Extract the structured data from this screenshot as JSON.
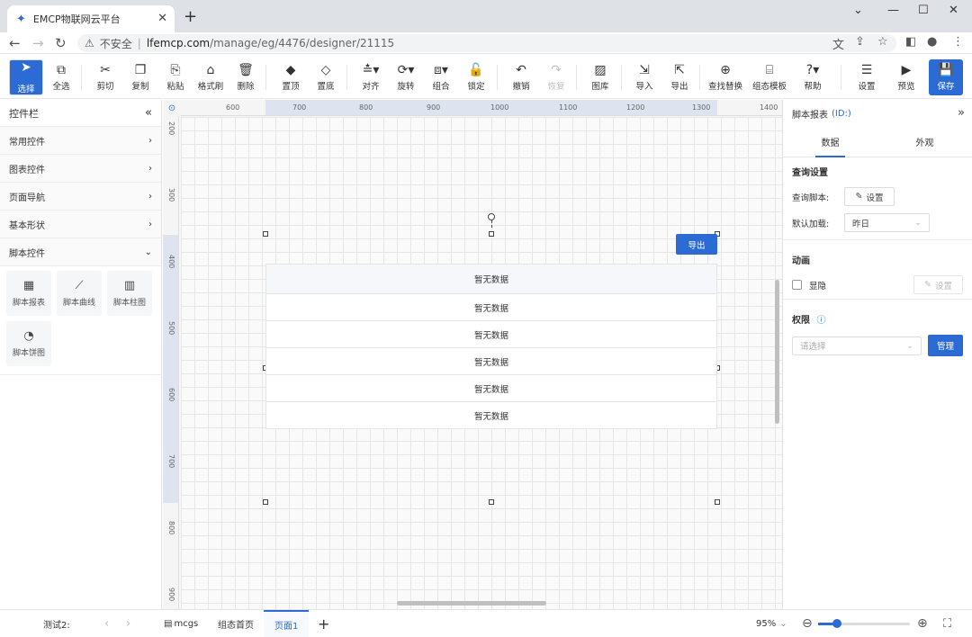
{
  "browser": {
    "tab_title": "EMCP物联网云平台",
    "address_insecure": "不安全",
    "address_host": "lfemcp.com",
    "address_path": "/manage/eg/4476/designer/21115"
  },
  "toolbar": {
    "select": "选择",
    "select_all": "全选",
    "cut": "剪切",
    "copy": "复制",
    "paste": "粘贴",
    "format_brush": "格式刷",
    "delete": "删除",
    "bring_top": "置顶",
    "send_bottom": "置底",
    "align": "对齐",
    "rotate": "旋转",
    "group": "组合",
    "lock": "锁定",
    "undo": "撤销",
    "redo": "恢复",
    "gallery": "图库",
    "import": "导入",
    "export": "导出",
    "find_replace": "查找替换",
    "templates": "组态模板",
    "help": "帮助",
    "settings": "设置",
    "preview": "预览",
    "save": "保存"
  },
  "left_panel": {
    "title": "控件栏",
    "categories": [
      "常用控件",
      "图表控件",
      "页面导航",
      "基本形状",
      "脚本控件"
    ],
    "script_controls": [
      {
        "label": "脚本报表",
        "icon": "table-icon"
      },
      {
        "label": "脚本曲线",
        "icon": "line-chart-icon"
      },
      {
        "label": "脚本柱图",
        "icon": "bar-chart-icon"
      },
      {
        "label": "脚本饼图",
        "icon": "pie-chart-icon"
      }
    ]
  },
  "ruler": {
    "h_ticks": [
      "600",
      "700",
      "800",
      "900",
      "1000",
      "1100",
      "1200",
      "1300",
      "1400"
    ],
    "v_ticks": [
      "200",
      "300",
      "400",
      "500",
      "600",
      "700",
      "800",
      "900"
    ]
  },
  "canvas": {
    "export_button": "导出",
    "table_header": "暂无数据",
    "table_rows": [
      "暂无数据",
      "暂无数据",
      "暂无数据",
      "暂无数据",
      "暂无数据"
    ]
  },
  "right_panel": {
    "title": "脚本报表",
    "id_label": "(ID:)",
    "tab_data": "数据",
    "tab_appearance": "外观",
    "query_section": "查询设置",
    "query_script_label": "查询脚本:",
    "query_script_btn": "设置",
    "default_load_label": "默认加载:",
    "default_load_value": "昨日",
    "anim_section": "动画",
    "anim_show_label": "显隐",
    "anim_settings_btn": "设置",
    "perm_section": "权限",
    "perm_placeholder": "请选择",
    "perm_manage_btn": "管理"
  },
  "statusbar": {
    "test_label": "测试2:",
    "page_tabs": [
      "mcgs",
      "组态首页",
      "页面1"
    ],
    "active_page": "页面1",
    "zoom": "95%"
  },
  "colors": {
    "accent": "#2d6bd4"
  }
}
